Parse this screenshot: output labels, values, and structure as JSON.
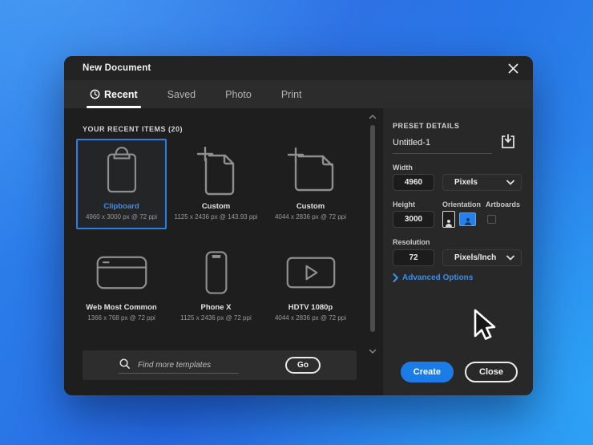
{
  "window": {
    "title": "New Document"
  },
  "tabs": [
    {
      "label": "Recent",
      "active": true,
      "icon": "clock-icon"
    },
    {
      "label": "Saved",
      "active": false
    },
    {
      "label": "Photo",
      "active": false
    },
    {
      "label": "Print",
      "active": false
    }
  ],
  "recent": {
    "header": "YOUR RECENT ITEMS (20)",
    "items": [
      {
        "name": "Clipboard",
        "dims": "4960 x 3000 px @ 72 ppi",
        "icon": "clipboard-icon",
        "selected": true
      },
      {
        "name": "Custom",
        "dims": "1125 x 2436 px @ 143.93 ppi",
        "icon": "document-portrait-crop-icon",
        "selected": false
      },
      {
        "name": "Custom",
        "dims": "4044 x 2836 px @ 72 ppi",
        "icon": "document-landscape-crop-icon",
        "selected": false
      },
      {
        "name": "Web Most Common",
        "dims": "1366 x 768 px @ 72 ppi",
        "icon": "browser-window-icon",
        "selected": false
      },
      {
        "name": "Phone X",
        "dims": "1125 x 2436 px @ 72 ppi",
        "icon": "smartphone-icon",
        "selected": false
      },
      {
        "name": "HDTV 1080p",
        "dims": "4044 x 2836 px @ 72 ppi",
        "icon": "tv-play-icon",
        "selected": false
      }
    ]
  },
  "search": {
    "placeholder": "Find more templates",
    "go_label": "Go"
  },
  "preset": {
    "header": "PRESET DETAILS",
    "name_value": "Untitled-1",
    "width_label": "Width",
    "width_value": "4960",
    "width_unit": "Pixels",
    "height_label": "Height",
    "height_value": "3000",
    "orientation_label": "Orientation",
    "artboards_label": "Artboards",
    "resolution_label": "Resolution",
    "resolution_value": "72",
    "resolution_unit": "Pixels/Inch",
    "advanced_label": "Advanced Options"
  },
  "actions": {
    "create_label": "Create",
    "close_label": "Close"
  },
  "colors": {
    "accent": "#2680EB",
    "link": "#3E8EE6",
    "selection_border": "#2680EB"
  }
}
